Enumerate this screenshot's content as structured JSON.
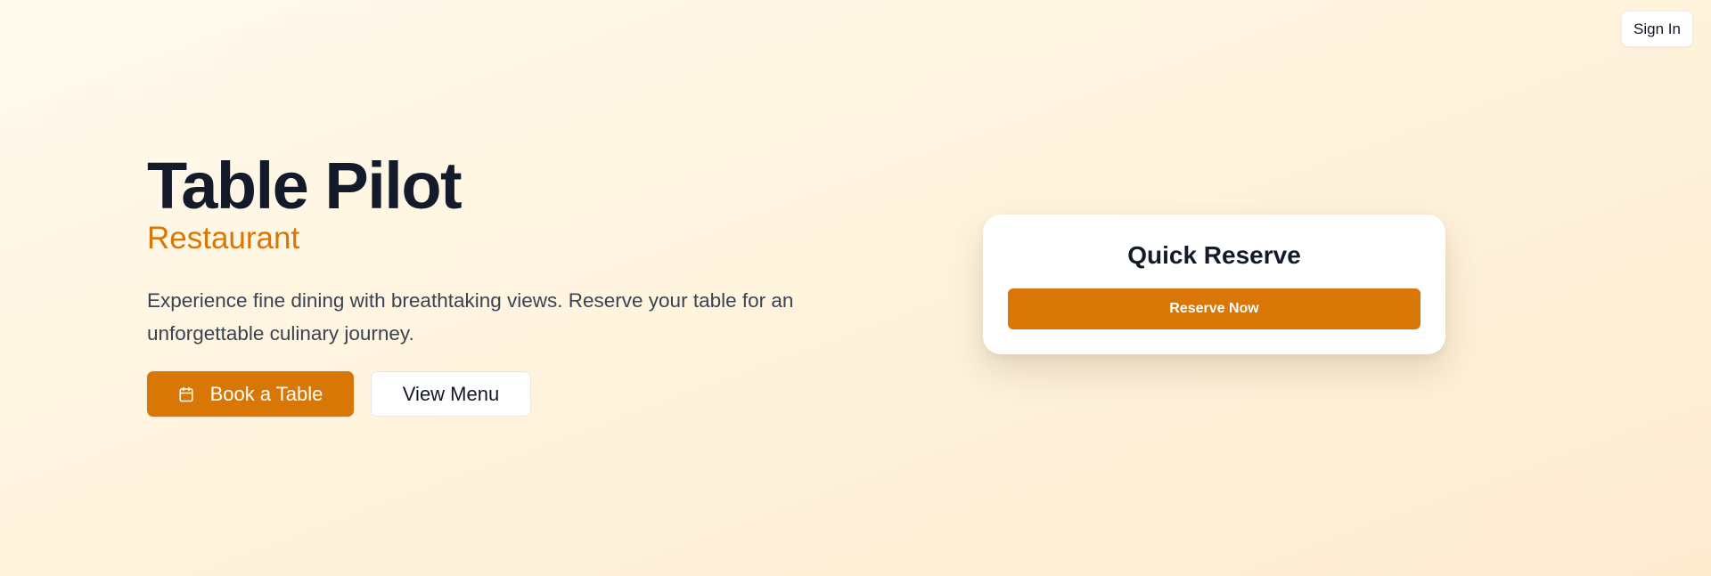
{
  "header": {
    "signin_label": "Sign In"
  },
  "hero": {
    "title": "Table Pilot",
    "subtitle": "Restaurant",
    "description": "Experience fine dining with breathtaking views. Reserve your table for an unforgettable culinary journey.",
    "book_label": "Book a Table",
    "book_icon": "calendar-icon",
    "menu_label": "View Menu"
  },
  "quick_reserve": {
    "title": "Quick Reserve",
    "button_label": "Reserve Now"
  },
  "colors": {
    "accent": "#d97706",
    "heading": "#131a2a",
    "body_text": "#3a4352",
    "background": "#fff4de"
  }
}
